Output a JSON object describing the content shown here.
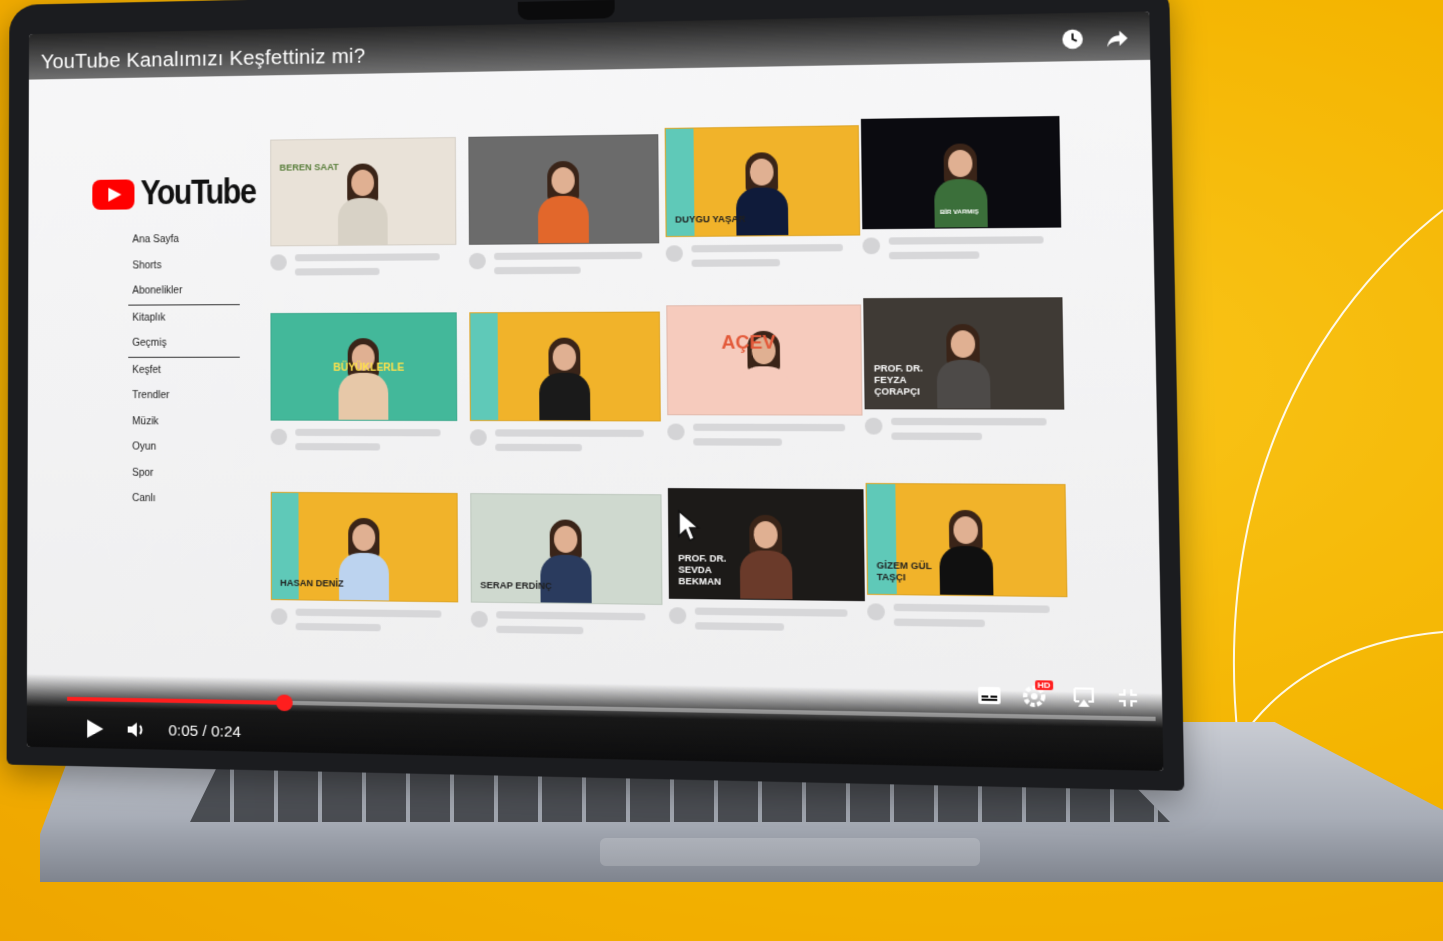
{
  "window": {
    "title": "YouTube Kanalımızı Keşfettiniz mi?",
    "top_icons": [
      "clock-icon",
      "share-icon"
    ]
  },
  "brand": {
    "name": "YouTube",
    "color": "#ff0000"
  },
  "sidebar": {
    "items": [
      {
        "label": "Ana Sayfa"
      },
      {
        "label": "Shorts"
      },
      {
        "label": "Abonelikler"
      },
      {
        "label": "Kitaplık"
      },
      {
        "label": "Geçmiş"
      },
      {
        "label": "Keşfet"
      },
      {
        "label": "Trendler"
      },
      {
        "label": "Müzik"
      },
      {
        "label": "Oyun"
      },
      {
        "label": "Spor"
      },
      {
        "label": "Canlı"
      }
    ]
  },
  "videos": [
    {
      "label": "BEREN SAAT",
      "bg": "#e9e2d8"
    },
    {
      "label": "",
      "bg": "#6b6b6b"
    },
    {
      "label": "DUYGU YAŞAR",
      "bg": "#f1b32a"
    },
    {
      "label": "BİR VARMIŞ",
      "bg": "#0b0b10"
    },
    {
      "label": "BÜYÜKLERLE",
      "bg": "#43b89a"
    },
    {
      "label": "",
      "bg": "#f1b32a"
    },
    {
      "label": "AÇEV",
      "bg": "#f6cbbd"
    },
    {
      "label": "PROF. DR. FEYZA ÇORAPÇI",
      "bg": "#3f3a35"
    },
    {
      "label": "HASAN DENİZ",
      "bg": "#f1b32a"
    },
    {
      "label": "SERAP ERDİNÇ",
      "bg": "#cfd9cf"
    },
    {
      "label": "PROF. DR. SEVDA BEKMAN",
      "bg": "#1c1a18"
    },
    {
      "label": "GİZEM GÜL TAŞÇI",
      "bg": "#f1b32a"
    }
  ],
  "player": {
    "time": "0:05 / 0:24",
    "progress": 0.21,
    "accent": "#ff1e1e",
    "right_icons": [
      "subtitles-icon",
      "settings-hd-icon",
      "airplay-icon",
      "exit-fullscreen-icon"
    ],
    "hd_badge": "HD"
  },
  "theme": {
    "background": "#f4b400"
  }
}
